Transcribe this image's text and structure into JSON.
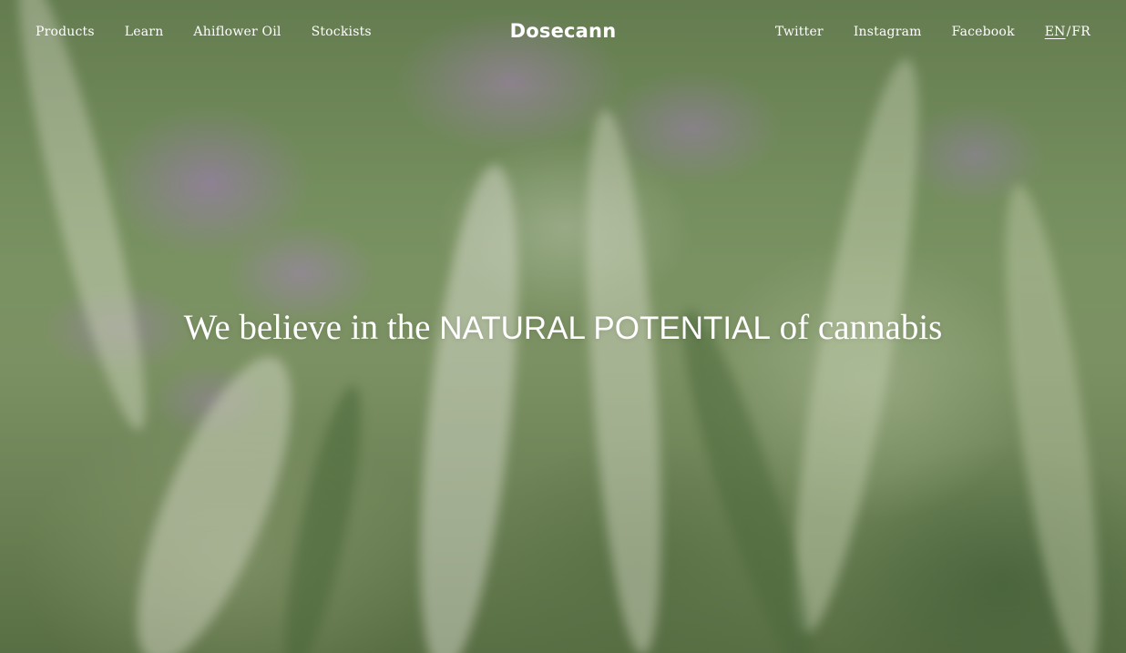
{
  "nav": {
    "left_items": [
      {
        "label": "Products"
      },
      {
        "label": "Learn"
      },
      {
        "label": "Ahiflower Oil"
      },
      {
        "label": "Stockists"
      }
    ],
    "brand": "Dosecann",
    "right_items": [
      {
        "label": "Twitter"
      },
      {
        "label": "Instagram"
      },
      {
        "label": "Facebook"
      }
    ],
    "language": {
      "current": "EN",
      "separator": "/",
      "other": "FR"
    }
  },
  "hero": {
    "headline_prefix": "We believe in the ",
    "headline_emphasis": "NATURAL POTENTIAL",
    "headline_suffix": " of cannabis"
  },
  "colors": {
    "text": "#ffffff",
    "meadow_green": "#7a9462",
    "flower_lavender": "#b08cd0"
  }
}
